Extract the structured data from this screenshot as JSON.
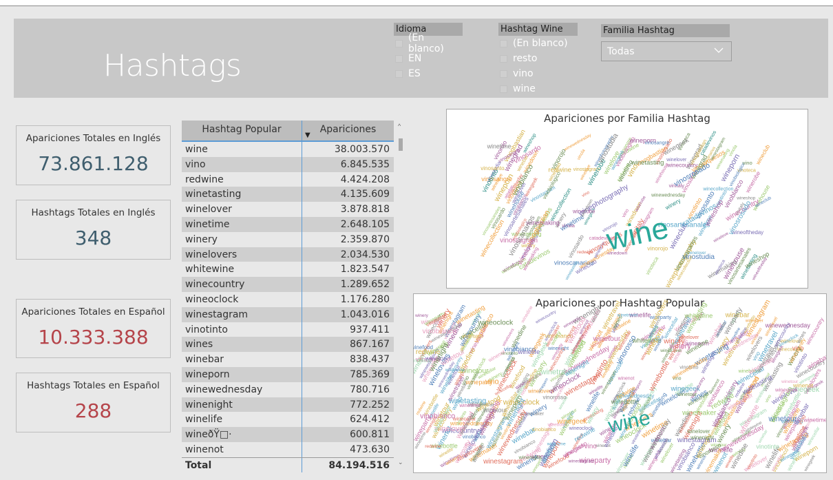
{
  "header": {
    "title": "Hashtags"
  },
  "slicers": {
    "idioma": {
      "title": "Idioma",
      "items": [
        "(En blanco)",
        "EN",
        "ES"
      ]
    },
    "hashtag_wine": {
      "title": "Hashtag Wine",
      "items": [
        "(En blanco)",
        "resto",
        "vino",
        "wine"
      ]
    },
    "familia": {
      "title": "Familia Hashtag",
      "selected": "Todas"
    }
  },
  "cards": {
    "apariciones_en": {
      "label": "Apariciones Totales en Inglés",
      "value": "73.861.128"
    },
    "hashtags_en": {
      "label": "Hashtags Totales en Inglés",
      "value": "348"
    },
    "apariciones_es": {
      "label": "Apariciones Totales en Español",
      "value": "10.333.388"
    },
    "hashtags_es": {
      "label": "Hashtags Totales en Español",
      "value": "288"
    }
  },
  "table": {
    "columns": [
      "Hashtag Popular",
      "Apariciones"
    ],
    "rows": [
      [
        "wine",
        "38.003.570"
      ],
      [
        "vino",
        "6.845.535"
      ],
      [
        "redwine",
        "4.424.208"
      ],
      [
        "winetasting",
        "4.135.609"
      ],
      [
        "winelover",
        "3.878.818"
      ],
      [
        "winetime",
        "2.648.105"
      ],
      [
        "winery",
        "2.359.870"
      ],
      [
        "winelovers",
        "2.034.530"
      ],
      [
        "whitewine",
        "1.823.547"
      ],
      [
        "winecountry",
        "1.289.652"
      ],
      [
        "wineoclock",
        "1.176.280"
      ],
      [
        "winestagram",
        "1.043.016"
      ],
      [
        "vinotinto",
        "937.411"
      ],
      [
        "wines",
        "867.167"
      ],
      [
        "winebar",
        "838.437"
      ],
      [
        "wineporn",
        "785.369"
      ],
      [
        "winewednesday",
        "780.716"
      ],
      [
        "winenight",
        "772.252"
      ],
      [
        "winelife",
        "624.412"
      ],
      [
        "wineðŸ□·",
        "600.811"
      ],
      [
        "winenot",
        "473.630"
      ]
    ],
    "total_label": "Total",
    "total_value": "84.194.516"
  },
  "clouds": {
    "familia": {
      "title": "Apariciones por Familia Hashtag",
      "big_word": "wine",
      "words": [
        "vino",
        "redwine",
        "winetime",
        "winelover",
        "winetasting",
        "vinostagram",
        "winehouse",
        "winephotography",
        "vinoteca",
        "catadevinos",
        "vinogbastian",
        "winerobe",
        "vinotinto",
        "winegrad",
        "wineshop",
        "winelove",
        "wineclub",
        "winegeek",
        "winedown",
        "vinobiologico",
        "vinosartesanales",
        "vinorojo",
        "winemaking",
        "vinosangre",
        "vinoscanarios",
        "vinostudia",
        "winecollection",
        "wineoftheday",
        "vinola",
        "vinosardo",
        "vinitaly",
        "winery",
        "vinoblanco",
        "winecountry",
        "winebar",
        "vinosanto",
        "wineporn",
        "winestagram",
        "winewednesday",
        "vinosyquesos",
        "vinosrosado"
      ],
      "colors": [
        "#7b6fb5",
        "#e06c5b",
        "#5aa7c9",
        "#9bc96f",
        "#f0a040",
        "#c86fa8",
        "#6a8d55",
        "#d4b24a",
        "#4f7fb8",
        "#a05a9a",
        "#888888",
        "#2e8f86"
      ]
    },
    "popular": {
      "title": "Apariciones por Hashtag Popular",
      "big_word": "wine",
      "words": [
        "vino",
        "redwine",
        "winetasting",
        "winelover",
        "winetime",
        "winery",
        "winelovers",
        "whitewine",
        "winecountry",
        "wineoclock",
        "winestagram",
        "vinotinto",
        "wines",
        "winebar",
        "wineporn",
        "winewednesday",
        "winenight",
        "winelife",
        "winenot",
        "winegeek",
        "winemaker",
        "winecellar",
        "vinorosso",
        "vinobianco",
        "winedine",
        "winetour",
        "wineparty",
        "winefood",
        "winetravel",
        "winebottle"
      ],
      "colors": [
        "#e06c5b",
        "#5aa7c9",
        "#9bc96f",
        "#f0a040",
        "#c86fa8",
        "#7b6fb5",
        "#6a8d55",
        "#d4b24a",
        "#4f7fb8",
        "#a05a9a",
        "#888888",
        "#e8a0c0",
        "#a0d8b0"
      ]
    }
  }
}
